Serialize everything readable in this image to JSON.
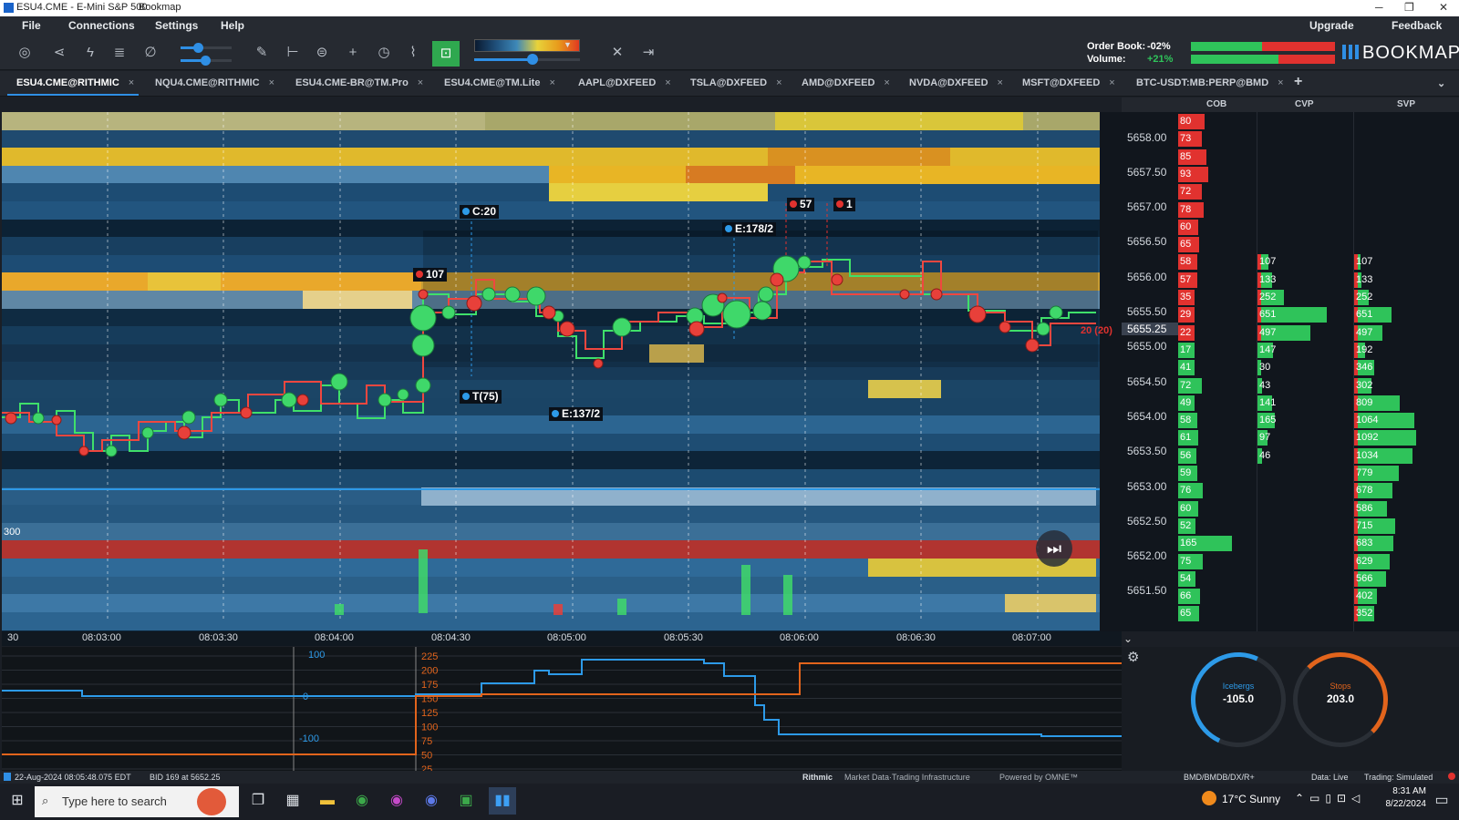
{
  "window": {
    "icon_label": "ESU4.CME - E-Mini S&P 500",
    "app": "Bookmap",
    "min": "─",
    "max": "❐",
    "close": "✕"
  },
  "menu": {
    "file": "File",
    "connections": "Connections",
    "settings": "Settings",
    "help": "Help",
    "upgrade": "Upgrade",
    "feedback": "Feedback"
  },
  "toolbar": {
    "order_book_label": "Order Book:",
    "order_book_value": "-02%",
    "volume_label": "Volume:",
    "volume_value": "+21%",
    "logo_text": "BOOKMAP",
    "icons": [
      "target-icon",
      "share-icon",
      "lightning-icon",
      "layers-icon",
      "link-icon",
      "brush-icon",
      "ruler-icon",
      "record-icon",
      "crosshair-icon",
      "timer-icon",
      "chart-line-icon",
      "lock-open-icon",
      "close-icon",
      "export-icon"
    ]
  },
  "tabs": [
    {
      "label": "ESU4.CME@RITHMIC",
      "active": true
    },
    {
      "label": "NQU4.CME@RITHMIC"
    },
    {
      "label": "ESU4.CME-BR@TM.Pro"
    },
    {
      "label": "ESU4.CME@TM.Lite"
    },
    {
      "label": "AAPL@DXFEED"
    },
    {
      "label": "TSLA@DXFEED"
    },
    {
      "label": "AMD@DXFEED"
    },
    {
      "label": "NVDA@DXFEED"
    },
    {
      "label": "MSFT@DXFEED"
    },
    {
      "label": "BTC-USDT:MB:PERP@BMD"
    }
  ],
  "tab_close": "×",
  "add_tab": "+",
  "columns": {
    "cob": "COB",
    "cvp": "CVP",
    "svp": "SVP"
  },
  "heatmap_labels": {
    "c20": "C:20",
    "e178": "E:178/2",
    "e137": "E:137/2",
    "t75": "T(75)",
    "n107": "107",
    "n57": "57",
    "n1": "1",
    "last": "20 (20)",
    "vol300": "300"
  },
  "prices": [
    "5658.00",
    "5657.50",
    "5657.00",
    "5656.50",
    "5656.00",
    "5655.50",
    "5655.25",
    "5655.00",
    "5654.50",
    "5654.00",
    "5653.50",
    "5653.00",
    "5652.50",
    "5652.00",
    "5651.50"
  ],
  "current_price": "5655.25",
  "cob": [
    {
      "v": "80",
      "s": "ask"
    },
    {
      "v": "73",
      "s": "ask"
    },
    {
      "v": "85",
      "s": "ask"
    },
    {
      "v": "93",
      "s": "ask"
    },
    {
      "v": "72",
      "s": "ask"
    },
    {
      "v": "78",
      "s": "ask"
    },
    {
      "v": "60",
      "s": "ask"
    },
    {
      "v": "65",
      "s": "ask"
    },
    {
      "v": "58",
      "s": "ask"
    },
    {
      "v": "57",
      "s": "ask"
    },
    {
      "v": "35",
      "s": "ask"
    },
    {
      "v": "29",
      "s": "ask"
    },
    {
      "v": "22",
      "s": "ask"
    },
    {
      "v": "17",
      "s": "bid"
    },
    {
      "v": "41",
      "s": "bid"
    },
    {
      "v": "72",
      "s": "bid"
    },
    {
      "v": "49",
      "s": "bid"
    },
    {
      "v": "58",
      "s": "bid"
    },
    {
      "v": "61",
      "s": "bid"
    },
    {
      "v": "56",
      "s": "bid"
    },
    {
      "v": "59",
      "s": "bid"
    },
    {
      "v": "76",
      "s": "bid"
    },
    {
      "v": "60",
      "s": "bid"
    },
    {
      "v": "52",
      "s": "bid"
    },
    {
      "v": "165",
      "s": "bid"
    },
    {
      "v": "75",
      "s": "bid"
    },
    {
      "v": "54",
      "s": "bid"
    },
    {
      "v": "66",
      "s": "bid"
    },
    {
      "v": "65",
      "s": "bid"
    }
  ],
  "cvp": [
    "107",
    "133",
    "252",
    "651",
    "497",
    "147",
    "30",
    "43",
    "141",
    "165",
    "97",
    "46"
  ],
  "svp": [
    "107",
    "133",
    "252",
    "651",
    "497",
    "192",
    "346",
    "302",
    "809",
    "1064",
    "1092",
    "1034",
    "779",
    "678",
    "586",
    "715",
    "683",
    "629",
    "566",
    "402",
    "352"
  ],
  "time_ticks": [
    "30",
    "08:03:00",
    "08:03:30",
    "08:04:00",
    "08:04:30",
    "08:05:00",
    "08:05:30",
    "08:06:00",
    "08:06:30",
    "08:07:00"
  ],
  "bottom_left_scale": [
    "100",
    "0",
    "-100"
  ],
  "bottom_mid_scale": [
    "225",
    "200",
    "175",
    "150",
    "125",
    "100",
    "75",
    "50",
    "25"
  ],
  "gauges": {
    "icebergs_label": "Icebergs",
    "icebergs_value": "-105.0",
    "stops_label": "Stops",
    "stops_value": "203.0"
  },
  "status": {
    "datetime": "22-Aug-2024 08:05:48.075 EDT",
    "bid": "BID 169 at 5652.25",
    "rithmic": "Rithmic",
    "rithmic_sub": "Market Data·Trading Infrastructure",
    "omne": "Powered by OMNE™",
    "feeds": "BMD/BMDB/DX/R+",
    "data": "Data: Live",
    "trading": "Trading: Simulated"
  },
  "taskbar": {
    "search_placeholder": "Type here to search",
    "weather": "17°C  Sunny",
    "time": "8:31 AM",
    "date": "8/22/2024"
  },
  "colors": {
    "ask": "#e1322f",
    "bid": "#2fc35a",
    "blue_line": "#2d9ae8",
    "orange_line": "#e2641c",
    "accent": "#2f8fe5"
  }
}
